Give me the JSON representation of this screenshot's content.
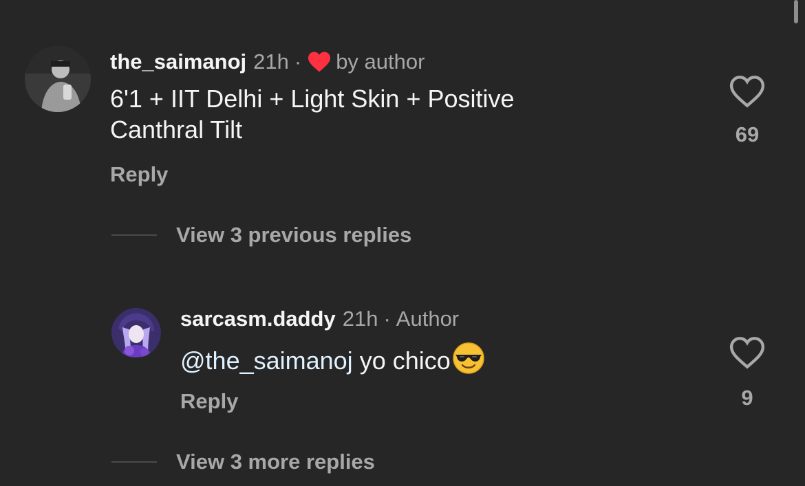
{
  "comment": {
    "username": "the_saimanoj",
    "time": "21h",
    "separator": "·",
    "liked_by": "by author",
    "text_line1": "6'1 + IIT Delhi + Light Skin + Positive",
    "text_line2": "Canthral Tilt",
    "reply_label": "Reply",
    "like_count": "69",
    "heart_color": "#ff3040"
  },
  "view_previous": "View 3 previous replies",
  "reply": {
    "username": "sarcasm.daddy",
    "time": "21h",
    "separator": "·",
    "badge": "Author",
    "mention": "@the_saimanoj",
    "text": " yo chico",
    "emoji": "smiling-face-with-sunglasses",
    "reply_label": "Reply",
    "like_count": "9"
  },
  "view_more": "View 3 more replies",
  "colors": {
    "background": "#262626",
    "primary_text": "#f5f5f5",
    "secondary_text": "#a8a8a8",
    "mention": "#e0f1ff"
  }
}
